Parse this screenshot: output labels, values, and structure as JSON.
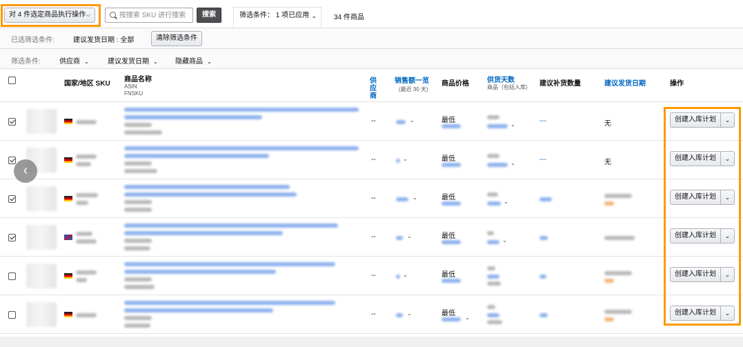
{
  "toolbar": {
    "bulk_action_label": "对 4 件选定商品执行操作",
    "search_placeholder": "按搜索 SKU 进行搜索",
    "search_button": "搜索",
    "filter_tab_label": "筛选条件： 1 项已应用",
    "product_count": "34 件商品"
  },
  "applied_filters": {
    "label": "已选筛选条件:",
    "value": "建议发货日期 : 全部",
    "clear_button": "清除筛选条件"
  },
  "filter_bar": {
    "label": "筛选条件:",
    "items": [
      "供应商",
      "建议发货日期",
      "隐藏商品"
    ]
  },
  "table": {
    "headers": {
      "country_sku": "国家/地区 SKU",
      "product_name": "商品名称",
      "asin": "ASIN",
      "fnsku": "FNSKU",
      "supplier": "供应商",
      "sales": "销售额一览",
      "sales_sub": "(最近 30 天)",
      "price": "商品价格",
      "supply_days": "供货天数",
      "supply_days_sub": "商品（包括入库)",
      "replenish_qty": "建议补货数量",
      "ship_date": "建议发货日期",
      "actions": "操作"
    },
    "rows": [
      {
        "checked": true,
        "dash": "--",
        "price": "最低",
        "replenish": "---",
        "ship_date": "无",
        "action": "创建入库计划"
      },
      {
        "checked": true,
        "dash": "--",
        "price": "最低",
        "replenish": "---",
        "ship_date": "无",
        "action": "创建入库计划"
      },
      {
        "checked": true,
        "dash": "--",
        "price": "最低",
        "replenish": "",
        "ship_date": "",
        "action": "创建入库计划"
      },
      {
        "checked": true,
        "dash": "--",
        "price": "最低",
        "replenish": "",
        "ship_date": "",
        "action": "创建入库计划"
      },
      {
        "checked": false,
        "dash": "--",
        "price": "最低",
        "replenish": "",
        "ship_date": "",
        "action": "创建入库计划"
      },
      {
        "checked": false,
        "dash": "--",
        "price": "最低",
        "replenish": "",
        "ship_date": "",
        "action": "创建入库计划"
      }
    ]
  },
  "icons": {
    "search": "search-icon",
    "dropdown": "chevron-down-icon",
    "scroll_left": "chevron-left-icon"
  },
  "colors": {
    "highlight": "#ff9900",
    "link": "#0066c0",
    "search_button_bg": "#4d4f52"
  }
}
